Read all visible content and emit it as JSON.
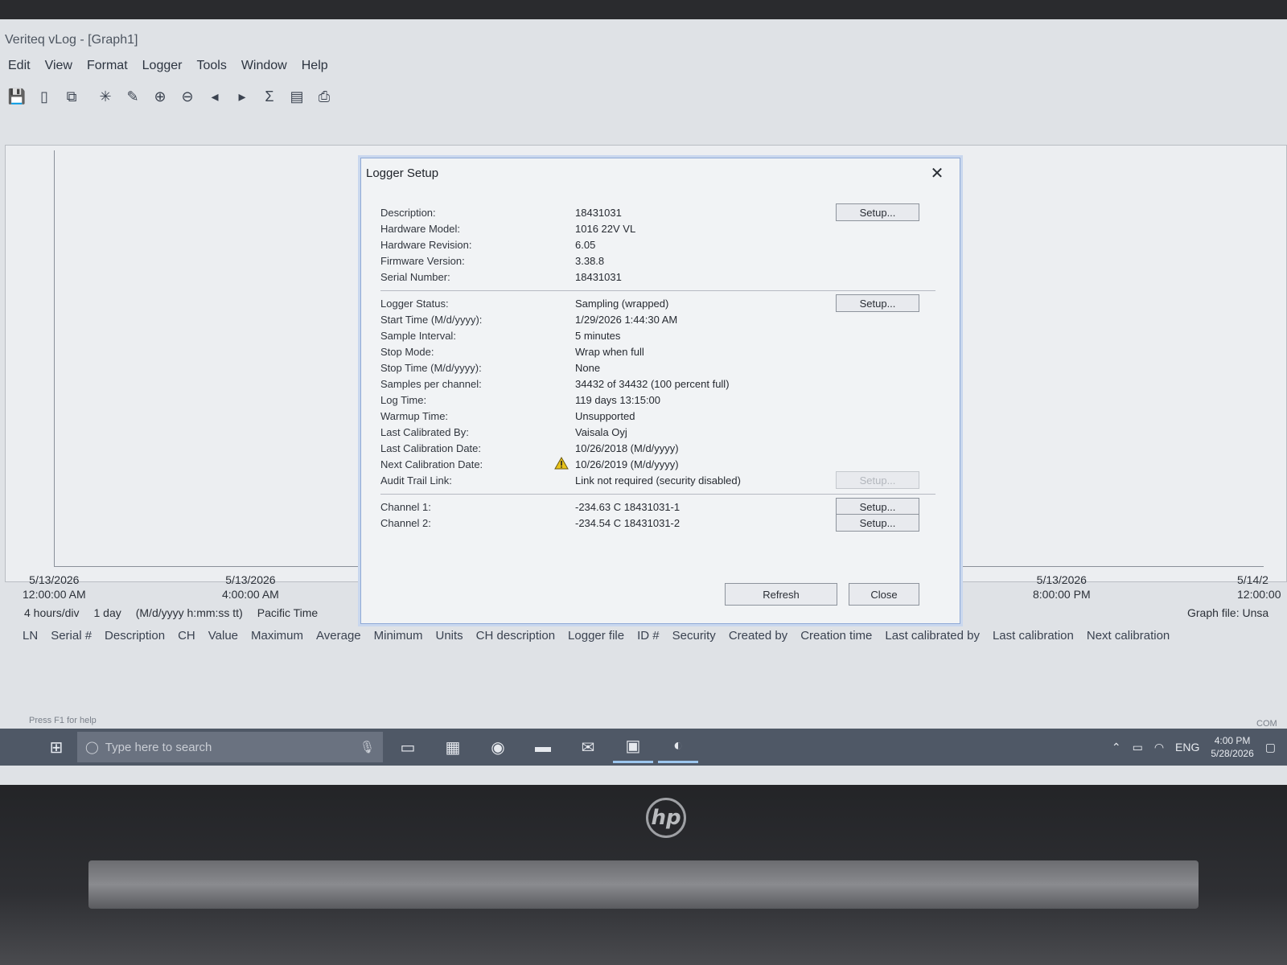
{
  "app": {
    "title": "Veriteq vLog - [Graph1]",
    "menu": [
      "Edit",
      "View",
      "Format",
      "Logger",
      "Tools",
      "Window",
      "Help"
    ]
  },
  "toolbar": {
    "icons": [
      "save-icon",
      "open-icon",
      "copy-icon",
      "cursor-icon",
      "edit-icon",
      "zoom-in-icon",
      "zoom-out-icon",
      "prev-icon",
      "next-icon",
      "stats-icon",
      "report-icon",
      "print-icon"
    ]
  },
  "graph": {
    "x_ticks": [
      {
        "date": "5/13/2026",
        "time": "12:00:00 AM"
      },
      {
        "date": "5/13/2026",
        "time": "4:00:00 AM"
      },
      {
        "date": "5/13/2026",
        "time": "8:00:00 PM"
      },
      {
        "date": "5/14/2",
        "time": "12:00:00"
      }
    ],
    "scale": "4 hours/div",
    "span": "1 day",
    "format": "(M/d/yyyy h:mm:ss tt)",
    "timezone": "Pacific Time",
    "graph_file": "Graph file: Unsa"
  },
  "columns": [
    "LN",
    "Serial #",
    "Description",
    "CH",
    "Value",
    "Maximum",
    "Average",
    "Minimum",
    "Units",
    "CH description",
    "Logger file",
    "ID #",
    "Security",
    "Created by",
    "Creation time",
    "Last calibrated by",
    "Last calibration",
    "Next calibration"
  ],
  "status": {
    "left": "Press F1 for help",
    "right": "COM"
  },
  "dialog": {
    "title": "Logger Setup",
    "close_glyph": "✕",
    "section1": [
      {
        "label": "Description:",
        "value": "18431031"
      },
      {
        "label": "Hardware Model:",
        "value": "1016 22V VL"
      },
      {
        "label": "Hardware Revision:",
        "value": "6.05"
      },
      {
        "label": "Firmware Version:",
        "value": "3.38.8"
      },
      {
        "label": "Serial Number:",
        "value": "18431031"
      }
    ],
    "section2": [
      {
        "label": "Logger Status:",
        "value": "Sampling (wrapped)"
      },
      {
        "label": "Start Time (M/d/yyyy):",
        "value": "1/29/2026 1:44:30 AM"
      },
      {
        "label": "Sample Interval:",
        "value": "5 minutes"
      },
      {
        "label": "Stop Mode:",
        "value": "Wrap when full"
      },
      {
        "label": "Stop Time (M/d/yyyy):",
        "value": "None"
      },
      {
        "label": "Samples per channel:",
        "value": "34432 of 34432  (100 percent full)"
      },
      {
        "label": "Log Time:",
        "value": "119 days 13:15:00"
      },
      {
        "label": "Warmup Time:",
        "value": "Unsupported"
      },
      {
        "label": "Last Calibrated By:",
        "value": "Vaisala Oyj"
      },
      {
        "label": "Last Calibration Date:",
        "value": "10/26/2018  (M/d/yyyy)"
      },
      {
        "label": "Next Calibration Date:",
        "value": "10/26/2019  (M/d/yyyy)"
      },
      {
        "label": "Audit Trail Link:",
        "value": "Link not required (security disabled)"
      }
    ],
    "section3": [
      {
        "label": "Channel 1:",
        "value": "-234.63 C    18431031-1"
      },
      {
        "label": "Channel 2:",
        "value": "-234.54 C    18431031-2"
      }
    ],
    "setup_label": "Setup...",
    "refresh_label": "Refresh",
    "close_label": "Close"
  },
  "taskbar": {
    "search_placeholder": "Type here to search",
    "tray_lang": "ENG",
    "time": "4:00 PM",
    "date": "5/28/2026"
  },
  "colors": {
    "accent": "#8fa9d6",
    "taskbar": "#4f5866",
    "warning": "#e8c21a"
  }
}
